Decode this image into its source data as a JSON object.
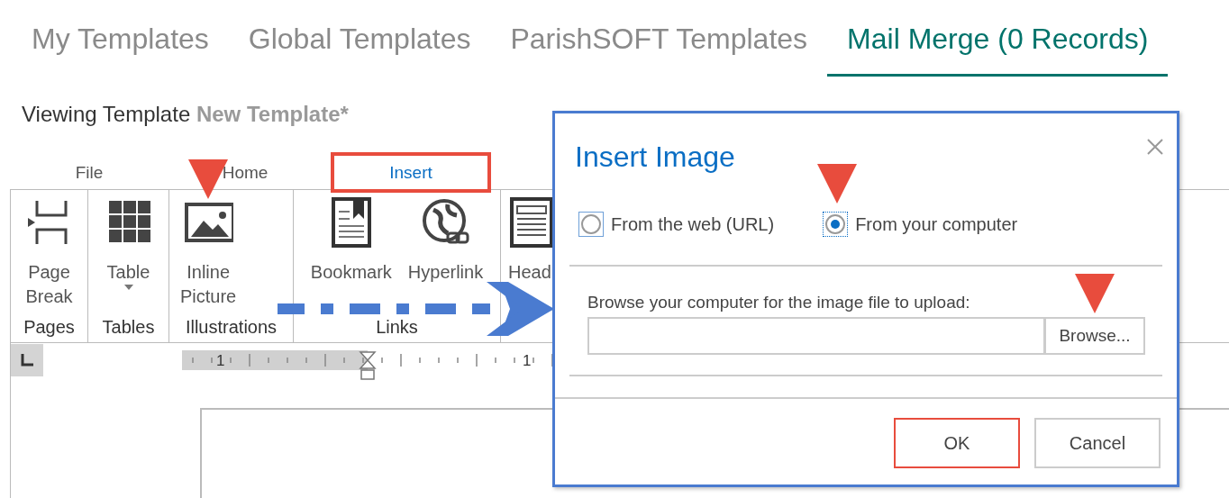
{
  "tabs": [
    {
      "label": "My Templates",
      "selected": false
    },
    {
      "label": "Global Templates",
      "selected": false
    },
    {
      "label": "ParishSOFT Templates",
      "selected": false
    },
    {
      "label": "Mail Merge (0 Records)",
      "selected": true
    }
  ],
  "viewing": {
    "label": "Viewing Template",
    "template_name": "New Template*"
  },
  "ribbon_tabs": [
    {
      "label": "File",
      "selected": false,
      "highlighted": false
    },
    {
      "label": "Home",
      "selected": false,
      "highlighted": false
    },
    {
      "label": "Insert",
      "selected": true,
      "highlighted": true
    }
  ],
  "ribbon_groups": [
    {
      "name": "Pages",
      "buttons": [
        {
          "label": "Page\nBreak",
          "kind": "pagebreak",
          "dropdown": false,
          "pointer": false
        }
      ]
    },
    {
      "name": "Tables",
      "buttons": [
        {
          "label": "Table",
          "kind": "table",
          "dropdown": true,
          "pointer": false
        }
      ]
    },
    {
      "name": "Illustrations",
      "buttons": [
        {
          "label": "Inline\nPicture",
          "kind": "picture",
          "dropdown": false,
          "pointer": true
        }
      ]
    },
    {
      "name": "Links",
      "buttons": [
        {
          "label": "Bookmark",
          "kind": "bookmark",
          "dropdown": false,
          "pointer": false
        },
        {
          "label": "Hyperlink",
          "kind": "hyperlink",
          "dropdown": false,
          "pointer": false
        }
      ]
    },
    {
      "buttons": [
        {
          "label": "Head",
          "kind": "document",
          "dropdown": false,
          "pointer": false
        }
      ]
    }
  ],
  "ruler": {
    "numbers": [
      "1",
      "1"
    ]
  },
  "dialog": {
    "title": "Insert Image",
    "options": [
      {
        "label": "From the web (URL)",
        "selected": false,
        "pointer": false
      },
      {
        "label": "From your computer",
        "selected": true,
        "pointer": true
      }
    ],
    "browse_label": "Browse your computer for the image file to upload:",
    "browse_button": {
      "label": "Browse...",
      "pointer": true
    },
    "buttons": [
      {
        "label": "OK",
        "highlighted": true
      },
      {
        "label": "Cancel",
        "highlighted": false
      }
    ]
  }
}
